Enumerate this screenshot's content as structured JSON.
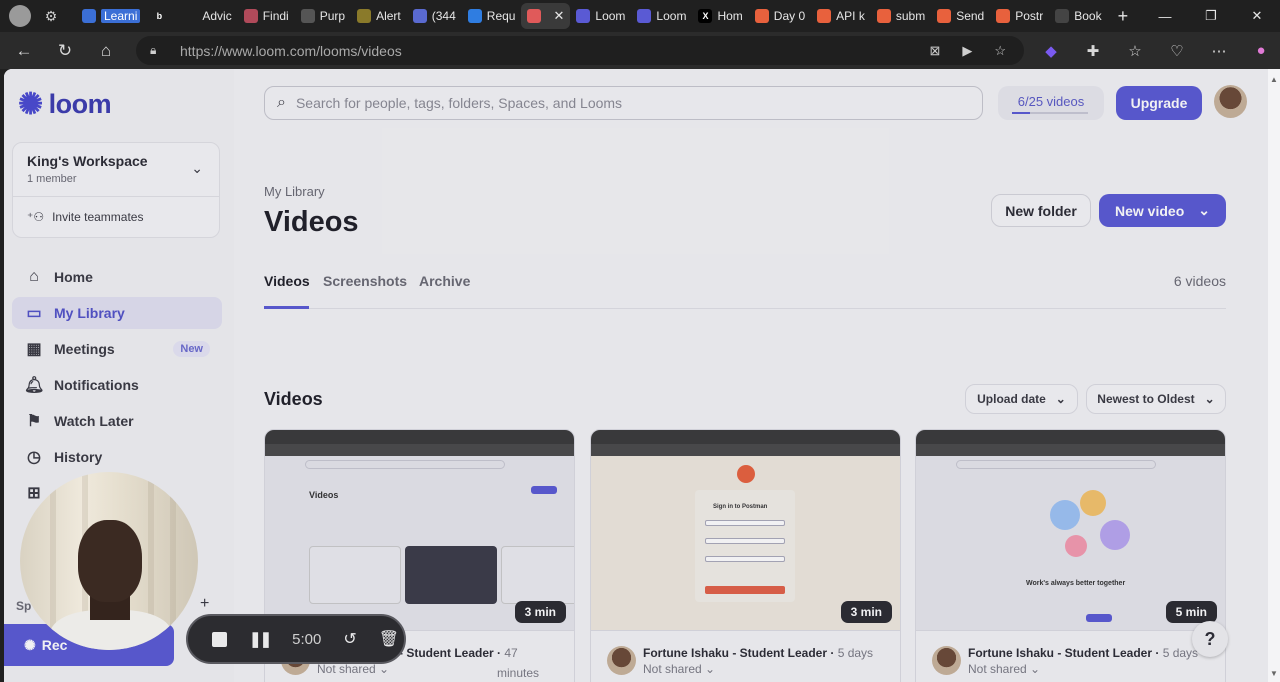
{
  "browser": {
    "tabs": [
      {
        "label": "Learni",
        "fav": "#3b6fd6",
        "icon": "learning-icon",
        "highlight": true
      },
      {
        "label": "",
        "fav": "#202020",
        "icon": "b-icon",
        "glyph": "b"
      },
      {
        "label": "Advic",
        "fav": "#202020",
        "icon": "advice-icon"
      },
      {
        "label": "Findi",
        "fav": "#b04a5a",
        "icon": "finding-icon"
      },
      {
        "label": "Purp",
        "fav": "#555555",
        "icon": "purpose-icon"
      },
      {
        "label": "Alert",
        "fav": "#8a7a2a",
        "icon": "alert-icon"
      },
      {
        "label": "(344",
        "fav": "#5a6ad0",
        "icon": "mail-icon"
      },
      {
        "label": "Requ",
        "fav": "#2f7de1",
        "icon": "request-icon"
      },
      {
        "label": "",
        "fav": "#e05a5a",
        "icon": "record-icon",
        "active": true
      },
      {
        "label": "Loom",
        "fav": "#5a5ad4",
        "icon": "loom-icon"
      },
      {
        "label": "Loom",
        "fav": "#5a5ad4",
        "icon": "loom-icon"
      },
      {
        "label": "Hom",
        "fav": "#000000",
        "icon": "x-icon",
        "glyph": "X"
      },
      {
        "label": "Day 0",
        "fav": "#e8613d",
        "icon": "postman-icon"
      },
      {
        "label": "API k",
        "fav": "#e8613d",
        "icon": "postman-icon"
      },
      {
        "label": "subm",
        "fav": "#e8613d",
        "icon": "postman-icon"
      },
      {
        "label": "Send",
        "fav": "#e8613d",
        "icon": "postman-icon"
      },
      {
        "label": "Postr",
        "fav": "#e8613d",
        "icon": "postman-icon"
      },
      {
        "label": "Book",
        "fav": "#444444",
        "icon": "book-icon"
      }
    ],
    "url_base": "https://www.loom.com",
    "url_path": "/looms/videos"
  },
  "sidebar": {
    "brand": "loom",
    "workspace_name": "King's Workspace",
    "workspace_members": "1 member",
    "invite_label": "Invite teammates",
    "nav": [
      {
        "label": "Home",
        "icon": "home-icon",
        "glyph": "⌂"
      },
      {
        "label": "My Library",
        "icon": "library-icon",
        "glyph": "▭",
        "active": true
      },
      {
        "label": "Meetings",
        "icon": "calendar-icon",
        "glyph": "▦",
        "badge": "New"
      },
      {
        "label": "Notifications",
        "icon": "bell-icon",
        "glyph": "🔔︎"
      },
      {
        "label": "Watch Later",
        "icon": "bookmark-icon",
        "glyph": "⚑"
      },
      {
        "label": "History",
        "icon": "history-icon",
        "glyph": "◷"
      },
      {
        "label": "",
        "icon": "gift-icon",
        "glyph": "⊞"
      }
    ],
    "spaces_label": "Sp",
    "record_label": "Rec"
  },
  "header": {
    "search_placeholder": "Search for people, tags, folders, Spaces, and Looms",
    "quota": "6/25 videos",
    "quota_progress": 0.24,
    "upgrade": "Upgrade"
  },
  "library": {
    "breadcrumb": "My Library",
    "title": "Videos",
    "new_folder": "New folder",
    "new_video": "New video",
    "tabs": [
      "Videos",
      "Screenshots",
      "Archive"
    ],
    "count": "6 videos",
    "section_title": "Videos",
    "sort_field": "Upload date",
    "sort_order": "Newest to Oldest"
  },
  "videos": [
    {
      "title": "Fortune Ishaku - Student Leader",
      "title_visible": "- Student Leader",
      "age": "47",
      "age_line2": "minutes",
      "share": "Not shared",
      "duration": "3 min",
      "kind": "library"
    },
    {
      "title": "Fortune Ishaku - Student Leader",
      "age": "5 days",
      "share": "Not shared",
      "duration": "3 min",
      "kind": "postman"
    },
    {
      "title": "Fortune Ishaku - Student Leader",
      "age": "5 days",
      "share": "Not shared",
      "duration": "5 min",
      "kind": "illustration"
    }
  ],
  "thumbs": {
    "t1_title": "Videos",
    "t2_title": "Sign in to Postman",
    "t3_title": "Work's always better together"
  },
  "recorder": {
    "timer": "5:00"
  },
  "help": "?"
}
